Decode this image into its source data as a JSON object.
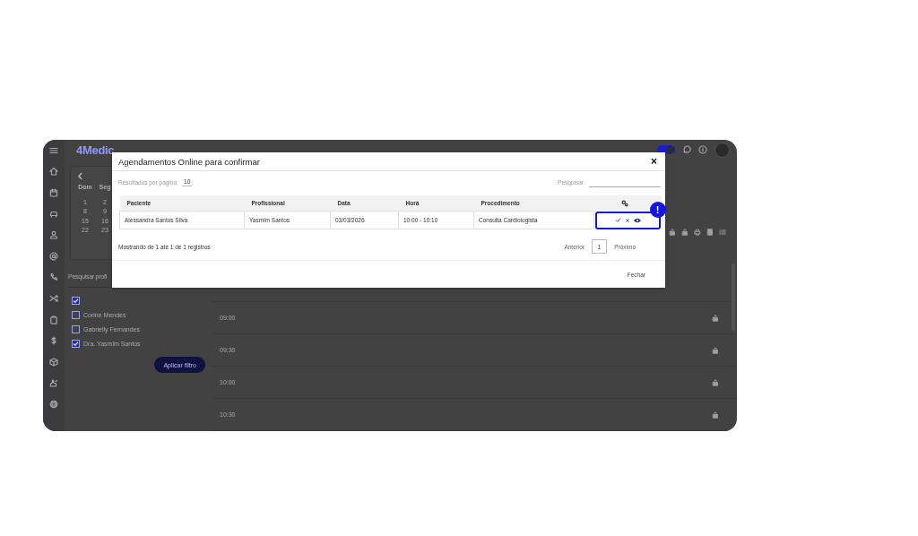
{
  "app": {
    "logo": "4Medic",
    "dark_mode_toggle": {
      "on": true
    }
  },
  "calendar": {
    "weekdays": [
      "Dom",
      "Seg"
    ],
    "weeks": [
      [
        "1",
        "2"
      ],
      [
        "8",
        "9"
      ],
      [
        "15",
        "16"
      ],
      [
        "22",
        "23"
      ]
    ]
  },
  "professional_search": {
    "placeholder": "Pesquisar profi"
  },
  "professionals": [
    {
      "checked": true
    },
    {
      "name": "Corine Mendes",
      "checked": false
    },
    {
      "name": "Gabrielly Fernandes",
      "checked": false
    },
    {
      "name": "Dra. Yasmim Santos",
      "checked": true
    }
  ],
  "apply_button": "Aplicar filtro",
  "time_slots": [
    "09:00",
    "09:30",
    "10:00",
    "10:30"
  ],
  "modal": {
    "title": "Agendamentos Online para confirmar",
    "close": "×",
    "page_size_label": "Resultados por página",
    "page_size": "10",
    "search_label": "Pesquisar",
    "columns": [
      "Paciente",
      "Profissional",
      "Data",
      "Hora",
      "Procedimento"
    ],
    "rows": [
      {
        "cells": [
          "Alessandra Santos Silva",
          "Yasmim Santos",
          "03/03/2026",
          "10:00 - 10:10",
          "Consulta Cardiologista"
        ],
        "actions_highlighted": true
      }
    ],
    "tour_marker": "!",
    "info": "Mostrando de 1 até 1 de 1 registros",
    "pagination": {
      "previous": "Anterior",
      "pages": [
        {
          "label": "1",
          "selected": true
        }
      ],
      "next": "Próximo"
    },
    "footer_button": "Fechar"
  }
}
